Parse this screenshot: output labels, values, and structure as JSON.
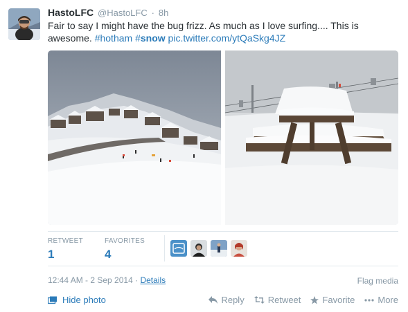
{
  "user": {
    "fullname": "HastoLFC",
    "username": "@HastoLFC",
    "separator": "·",
    "time": "8h"
  },
  "tweet": {
    "text": "Fair to say I might have the bug frizz. As much as I love surfing.... This is awesome.",
    "hashtag1": "#hotham",
    "hashtag2_hash": "#",
    "hashtag2_word": "snow",
    "link": "pic.twitter.com/ytQaSkg4JZ"
  },
  "stats": {
    "retweet_label": "RETWEET",
    "retweet_count": "1",
    "favorites_label": "FAVORITES",
    "favorites_count": "4"
  },
  "meta": {
    "timestamp": "12:44 AM - 2 Sep 2014",
    "separator": "·",
    "details_link": "Details",
    "flag_media": "Flag media"
  },
  "footer": {
    "hide_photo": "Hide photo",
    "reply": "Reply",
    "retweet": "Retweet",
    "favorite": "Favorite",
    "more": "More"
  },
  "colors": {
    "link": "#2b7bb9",
    "muted": "#8899a6",
    "text": "#292f33",
    "border": "#e1e8ed"
  },
  "icons": [
    "photo-icon",
    "reply-icon",
    "retweet-icon",
    "favorite-star-icon",
    "more-dots-icon"
  ]
}
